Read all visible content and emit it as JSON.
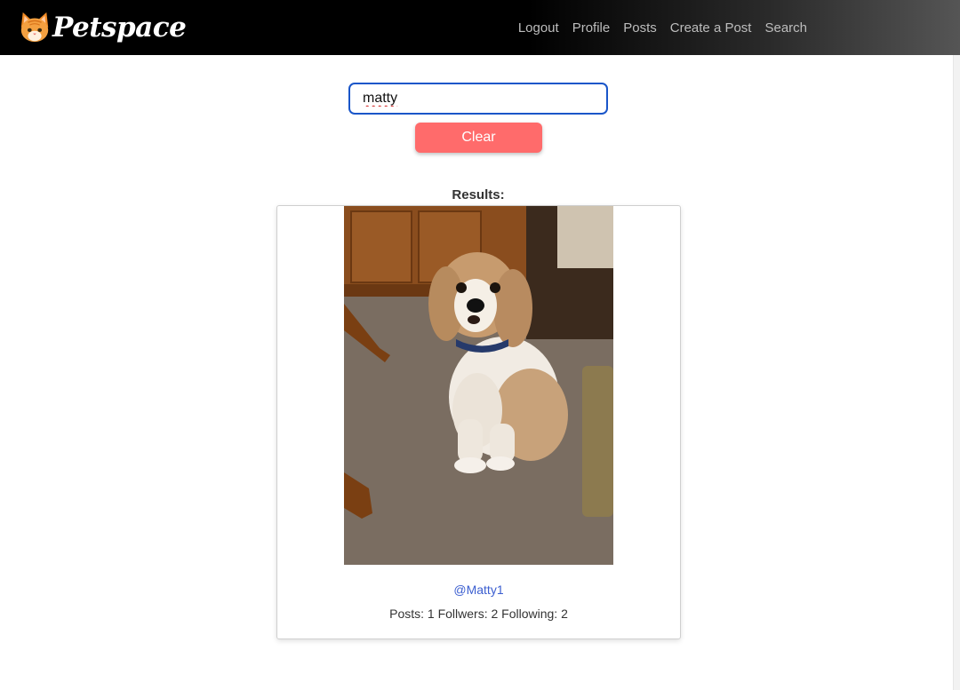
{
  "app": {
    "brand_name": "Petspace"
  },
  "nav": {
    "items": [
      {
        "label": "Logout"
      },
      {
        "label": "Profile"
      },
      {
        "label": "Posts"
      },
      {
        "label": "Create a Post"
      },
      {
        "label": "Search"
      }
    ]
  },
  "search": {
    "value": "matty",
    "clear_label": "Clear"
  },
  "results": {
    "heading": "Results:",
    "items": [
      {
        "username": "@Matty1",
        "stats_text": "Posts: 1 Follwers: 2 Following: 2"
      }
    ]
  },
  "colors": {
    "clear_button": "#ff6b6b",
    "input_focus_border": "#1a56c9",
    "link": "#3b5ed0"
  }
}
